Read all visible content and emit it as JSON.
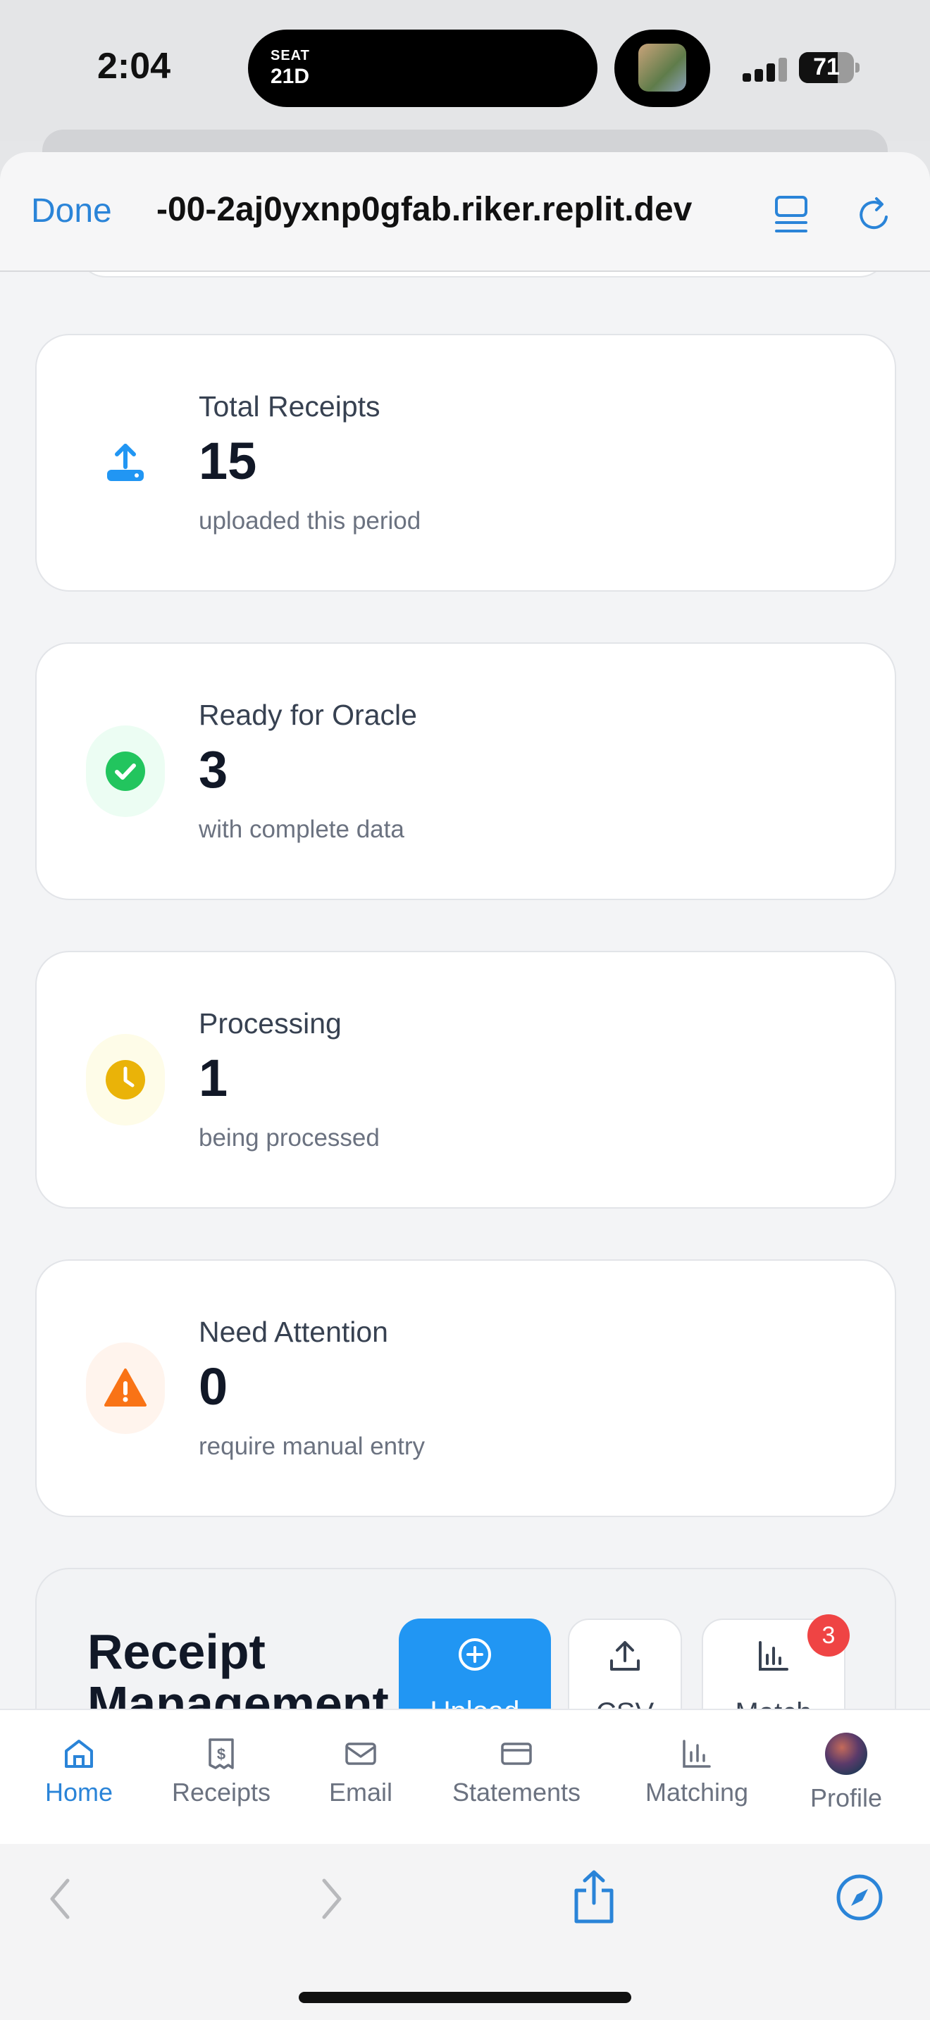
{
  "status_bar": {
    "time": "2:04",
    "live_activity": {
      "label_small": "SEAT",
      "label_big": "21D"
    },
    "battery": "71"
  },
  "browser": {
    "done_label": "Done",
    "url": "-00-2aj0yxnp0gfab.riker.replit.dev"
  },
  "stats": [
    {
      "title": "Total Receipts",
      "value": "15",
      "subtitle": "uploaded this period",
      "icon": "upload-icon",
      "color": "#2196f3"
    },
    {
      "title": "Ready for Oracle",
      "value": "3",
      "subtitle": "with complete data",
      "icon": "check-circle-icon",
      "color": "#22c55e"
    },
    {
      "title": "Processing",
      "value": "1",
      "subtitle": "being processed",
      "icon": "clock-icon",
      "color": "#eab308"
    },
    {
      "title": "Need Attention",
      "value": "0",
      "subtitle": "require manual entry",
      "icon": "warning-icon",
      "color": "#f97316"
    }
  ],
  "management": {
    "heading": "Receipt Management",
    "actions": {
      "upload": "Upload",
      "csv": "CSV",
      "match": "Match"
    },
    "match_badge": "3"
  },
  "tabs": [
    {
      "label": "Home",
      "icon": "home-icon",
      "active": true
    },
    {
      "label": "Receipts",
      "icon": "receipt-icon",
      "active": false
    },
    {
      "label": "Email",
      "icon": "mail-icon",
      "active": false
    },
    {
      "label": "Statements",
      "icon": "card-icon",
      "active": false
    },
    {
      "label": "Matching",
      "icon": "chart-icon",
      "active": false
    },
    {
      "label": "Profile",
      "icon": "avatar",
      "active": false
    }
  ]
}
